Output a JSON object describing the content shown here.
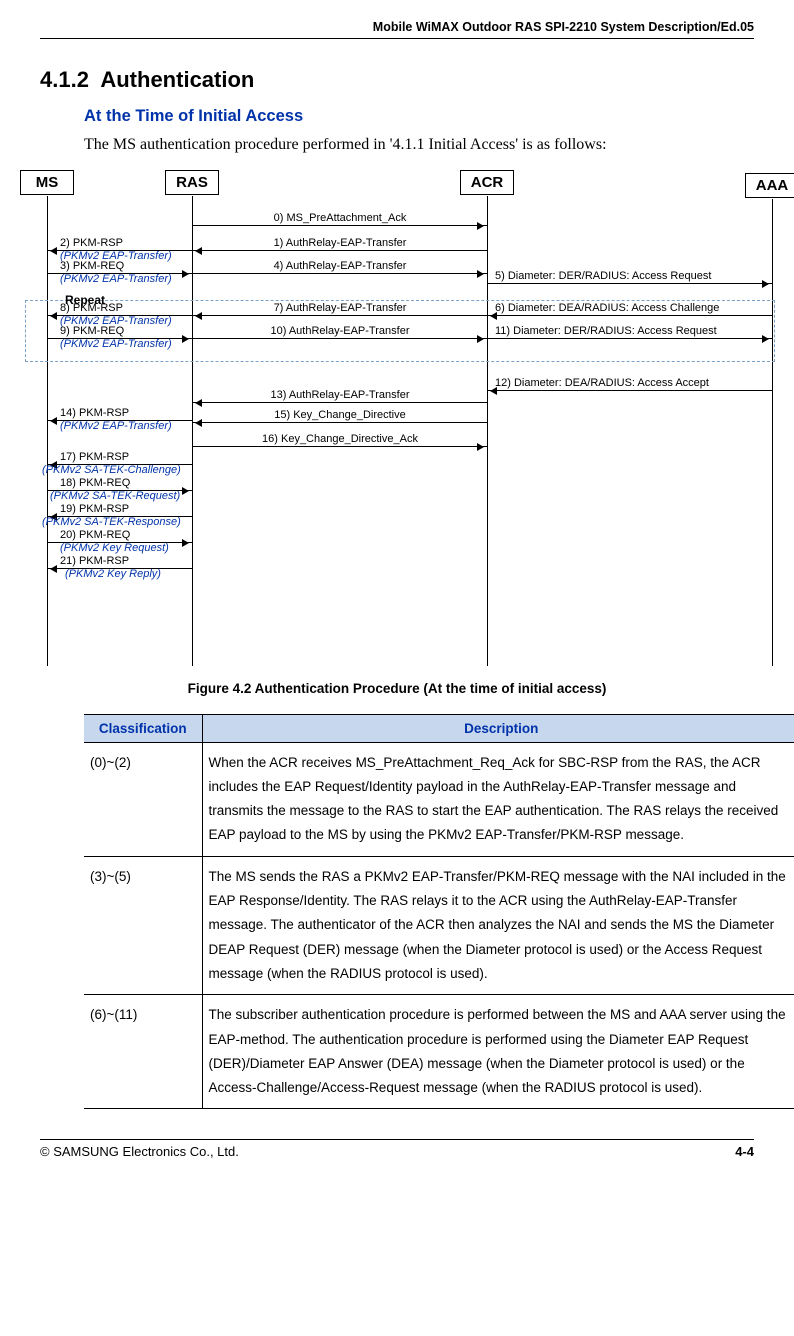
{
  "doc_header": "Mobile WiMAX Outdoor RAS SPI-2210 System Description/Ed.05",
  "section": {
    "number": "4.1.2",
    "title": "Authentication"
  },
  "subheading": "At the Time of Initial Access",
  "intro": "The MS authentication procedure performed in '4.1.1 Initial Access' is as follows:",
  "diagram": {
    "nodes": {
      "ms": "MS",
      "ras": "RAS",
      "acr": "ACR",
      "aaa": "AAA"
    },
    "repeat_label": "Repeat",
    "messages": {
      "m0": "0) MS_PreAttachment_Ack",
      "m1": "1) AuthRelay-EAP-Transfer",
      "m2": "2) PKM-RSP",
      "m2s": "(PKMv2 EAP-Transfer)",
      "m3": "3) PKM-REQ",
      "m3s": "(PKMv2 EAP-Transfer)",
      "m4": "4) AuthRelay-EAP-Transfer",
      "m5": "5) Diameter: DER/RADIUS: Access Request",
      "m6": "6) Diameter: DEA/RADIUS: Access Challenge",
      "m7": "7) AuthRelay-EAP-Transfer",
      "m8": "8) PKM-RSP",
      "m8s": "(PKMv2 EAP-Transfer)",
      "m9": "9) PKM-REQ",
      "m9s": "(PKMv2 EAP-Transfer)",
      "m10": "10) AuthRelay-EAP-Transfer",
      "m11": "11) Diameter: DER/RADIUS: Access Request",
      "m12": "12) Diameter: DEA/RADIUS: Access Accept",
      "m13": "13) AuthRelay-EAP-Transfer",
      "m14": "14) PKM-RSP",
      "m14s": "(PKMv2 EAP-Transfer)",
      "m15": "15) Key_Change_Directive",
      "m16": "16) Key_Change_Directive_Ack",
      "m17": "17) PKM-RSP",
      "m17s": "(PKMv2 SA-TEK-Challenge)",
      "m18": "18) PKM-REQ",
      "m18s": "(PKMv2 SA-TEK-Request)",
      "m19": "19) PKM-RSP",
      "m19s": "(PKMv2 SA-TEK-Response)",
      "m20": "20) PKM-REQ",
      "m20s": "(PKMv2 Key Request)",
      "m21": "21) PKM-RSP",
      "m21s": "(PKMv2 Key Reply)"
    }
  },
  "figure_caption": "Figure 4.2    Authentication Procedure (At the time of initial access)",
  "table": {
    "headers": {
      "c1": "Classification",
      "c2": "Description"
    },
    "rows": [
      {
        "c1": "(0)~(2)",
        "c2": "When the ACR receives MS_PreAttachment_Req_Ack for SBC-RSP from the RAS, the ACR includes the EAP Request/Identity payload in the AuthRelay-EAP-Transfer message and transmits the message to the RAS to start the EAP authentication. The RAS relays the received EAP payload to the MS by using the PKMv2 EAP-Transfer/PKM-RSP message."
      },
      {
        "c1": "(3)~(5)",
        "c2": "The MS sends the RAS a PKMv2 EAP-Transfer/PKM-REQ message with the NAI included in the EAP Response/Identity. The RAS relays it to the ACR using the AuthRelay-EAP-Transfer message. The authenticator of the ACR then analyzes the NAI and sends the MS the Diameter DEAP Request (DER) message (when the Diameter protocol is used) or the Access Request message (when the RADIUS protocol is used)."
      },
      {
        "c1": "(6)~(11)",
        "c2": "The subscriber authentication procedure is performed between the MS and AAA server using the EAP-method. The authentication procedure is performed using the Diameter EAP Request (DER)/Diameter EAP Answer (DEA) message (when the Diameter protocol is used) or the Access-Challenge/Access-Request message (when the RADIUS protocol is used)."
      }
    ]
  },
  "footer": {
    "left": "© SAMSUNG Electronics Co., Ltd.",
    "right": "4-4"
  }
}
